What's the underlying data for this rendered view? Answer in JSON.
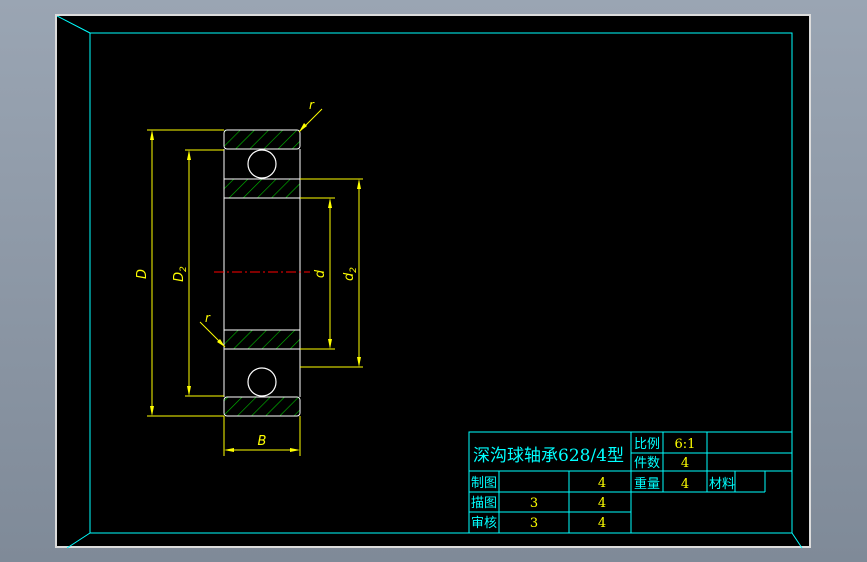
{
  "colors": {
    "frame": "#00ffff",
    "part": "#ffffff",
    "hatch": "#00c000",
    "dimension": "#ffff00",
    "centerline": "#ff0000",
    "background": "#000000"
  },
  "dimensions": {
    "outer_diameter": "D",
    "outer_ring_inner_diameter": "D",
    "outer_ring_inner_diameter_sub": "2",
    "bore": "d",
    "inner_ring_outer_diameter": "d",
    "inner_ring_outer_diameter_sub": "2",
    "width": "B",
    "fillet_top": "r",
    "fillet_bottom": "r"
  },
  "title_block": {
    "title": "深沟球轴承628/4型",
    "scale_label": "比例",
    "scale_value": "6:1",
    "count_label": "件数",
    "count_value": "4",
    "weight_label": "重量",
    "weight_value": "4",
    "material_label": "材料",
    "rows": [
      {
        "label": "制图",
        "col1": "",
        "col2": "4"
      },
      {
        "label": "描图",
        "col1": "3",
        "col2": "4"
      },
      {
        "label": "审核",
        "col1": "3",
        "col2": "4"
      }
    ]
  }
}
